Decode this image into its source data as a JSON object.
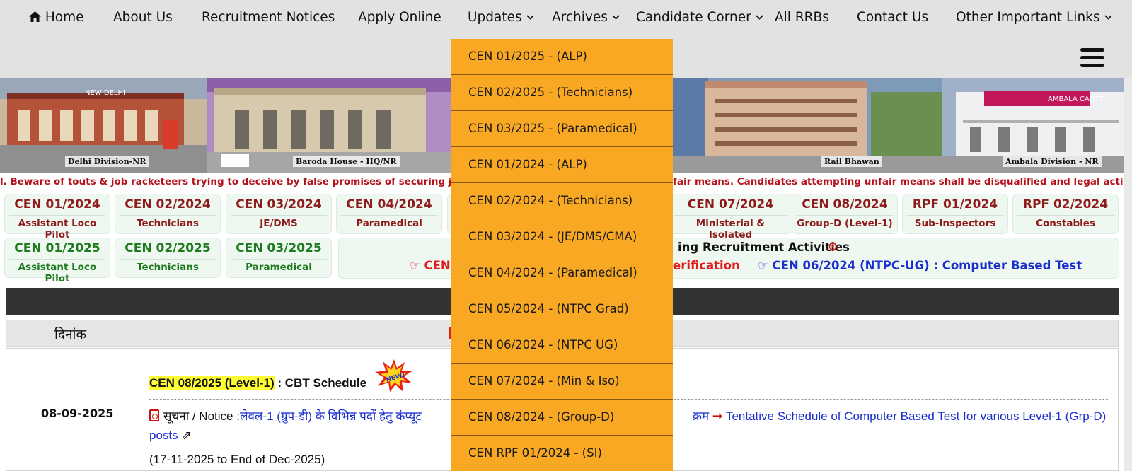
{
  "nav": {
    "items": [
      {
        "label": "Home",
        "icon": "home-icon"
      },
      {
        "label": "About Us"
      },
      {
        "label": "Recruitment Notices"
      },
      {
        "label": "Apply Online"
      },
      {
        "label": "Updates",
        "caret": true
      },
      {
        "label": "Archives",
        "caret": true
      },
      {
        "label": "Candidate Corner",
        "caret": true
      },
      {
        "label": "All RRBs"
      },
      {
        "label": "Contact Us"
      },
      {
        "label": "Other Important Links",
        "caret": true
      }
    ],
    "menu_icon": "hamburger-menu-icon"
  },
  "banner": {
    "captions": [
      "Delhi Division-NR",
      "Baroda House - HQ/NR",
      "Rail Bhawan",
      "Ambala Division - NR"
    ],
    "sign_text": [
      "NEW DELHI",
      "AMBALA CANTT"
    ]
  },
  "ticker": {
    "text_left": "l. Beware of touts & job racketeers trying to deceive by false promises of securing job in Rai",
    "text_right": "fair means. Candidates attempting unfair means shall be disqualified and legal action shal"
  },
  "cards_row1": [
    {
      "code": "CEN 01/2024",
      "name": "Assistant Loco Pilot"
    },
    {
      "code": "CEN 02/2024",
      "name": "Technicians"
    },
    {
      "code": "CEN 03/2024",
      "name": "JE/DMS"
    },
    {
      "code": "CEN 04/2024",
      "name": "Paramedical"
    },
    {
      "code": "CEN 07/2024",
      "name": "Ministerial & Isolated"
    },
    {
      "code": "CEN 08/2024",
      "name": "Group-D (Level-1)"
    },
    {
      "code": "RPF 01/2024",
      "name": "Sub-Inspectors"
    },
    {
      "code": "RPF 02/2024",
      "name": "Constables"
    }
  ],
  "cards_row2": [
    {
      "code": "CEN 01/2025",
      "name": "Assistant Loco Pilot"
    },
    {
      "code": "CEN 02/2025",
      "name": "Technicians"
    },
    {
      "code": "CEN 03/2025",
      "name": "Paramedical"
    }
  ],
  "ongoing": {
    "title": "ing Recruitment Activities",
    "item1": "CEN",
    "item2": "erification",
    "item3": "CEN 06/2024 (NTPC-UG) : Computer Based Test"
  },
  "table": {
    "date_header": "दिनांक",
    "row": {
      "date": "08-09-2025",
      "title_highlight": "CEN 08/2025 (Level-1)",
      "title_rest": " : CBT Schedule",
      "new_badge": "NEW!",
      "notice_label": "सूचना / Notice :",
      "notice_hindi": "लेवल-1 (ग्रुप-डी) के विभिन्न पदों हेतु कंप्यूट",
      "notice_hindi_end": "क्रम",
      "notice_english": "Tentative Schedule of Computer Based Test for various Level-1 (Grp-D)",
      "notice_english_cont": "posts",
      "date_range": "(17-11-2025 to End of Dec-2025)"
    }
  },
  "dropdown": {
    "items": [
      "CEN 01/2025 - (ALP)",
      "CEN 02/2025 - (Technicians)",
      "CEN 03/2025 - (Paramedical)",
      "CEN 01/2024 - (ALP)",
      "CEN 02/2024 - (Technicians)",
      "CEN 03/2024 - (JE/DMS/CMA)",
      "CEN 04/2024 - (Paramedical)",
      "CEN 05/2024 - (NTPC Grad)",
      "CEN 06/2024 - (NTPC UG)",
      "CEN 07/2024 - (Min & Iso)",
      "CEN 08/2024 - (Group-D)",
      "CEN RPF 01/2024 - (SI)"
    ]
  },
  "colors": {
    "nav_bg": "#e2e2e2",
    "dropdown_bg": "#f8a823",
    "card_bg": "#eef8f1",
    "red_text": "#8e1b1b",
    "green_text": "#1d7a1d",
    "ticker_text": "#b5121b",
    "highlight": "#ffff33",
    "link_blue": "#1a2fcc"
  }
}
